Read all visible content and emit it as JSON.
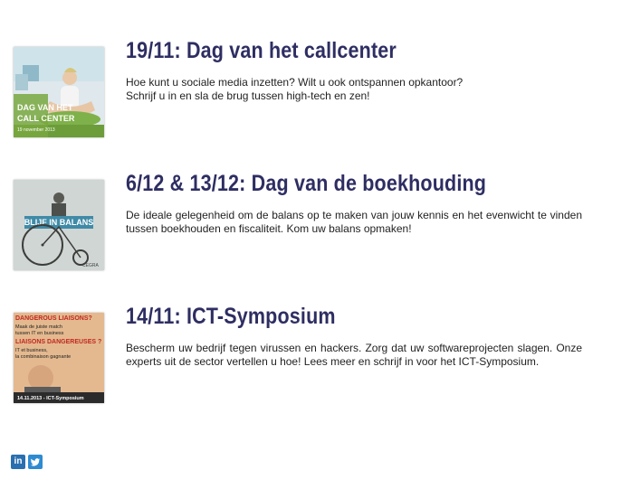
{
  "events": [
    {
      "title": "19/11: Dag van het callcenter",
      "description": "Hoe kunt u sociale media inzetten? Wilt u ook ontspannen opkantoor?\nSchrijf u in en sla de brug tussen high-tech en zen!",
      "thumb_text": [
        "DAG VAN HET",
        "CALL CENTER",
        "19 november 2013"
      ]
    },
    {
      "title": "6/12 & 13/12: Dag van de boekhouding",
      "description": "De ideale gelegenheid om de balans op te maken van jouw kennis en het evenwicht te vinden tussen boekhouden en fiscaliteit. Kom uw balans opmaken!",
      "thumb_text": [
        "BLIJF IN BALANS",
        "CEGRA"
      ]
    },
    {
      "title": "14/11: ICT-Symposium",
      "description": "Bescherm uw bedrijf tegen virussen en hackers. Zorg dat uw softwareprojecten slagen. Onze experts uit de sector vertellen u hoe! Lees meer en schrijf in voor het ICT-Symposium.",
      "thumb_text": [
        "DANGEROUS LIAISONS?",
        "Maak de juiste match",
        "tussen IT en business",
        "LIAISONS DANGEREUSES ?",
        "IT et business,",
        "la combinaison gagnante",
        "14.11.2013 - ICT-Symposium"
      ]
    }
  ],
  "social": {
    "linkedin": {
      "icon": "linkedin-icon",
      "glyph": "in",
      "color": "#2a6fb0"
    },
    "twitter": {
      "icon": "twitter-icon",
      "color": "#2f8bd1"
    }
  }
}
